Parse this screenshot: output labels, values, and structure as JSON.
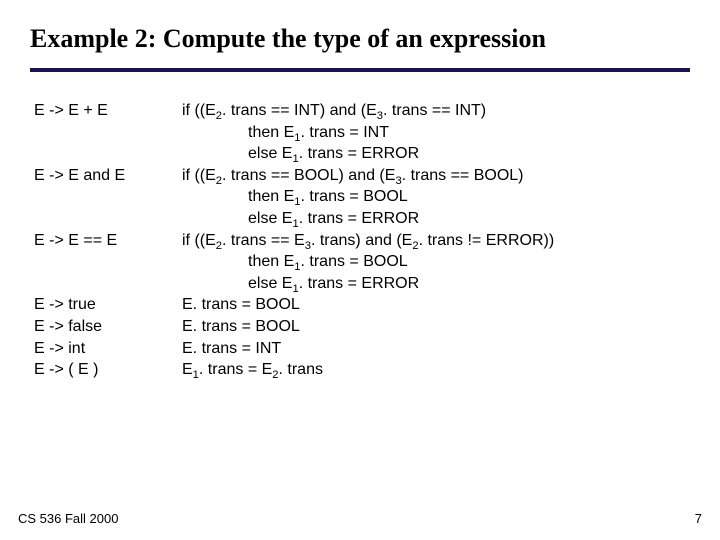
{
  "title": "Example 2: Compute the type of an expression",
  "rules": [
    {
      "lhs": "E -> E + E",
      "lines": [
        {
          "indent": false,
          "plain": "if ((E",
          "sub2": true,
          "rest": ". trans == INT) and (E",
          "sub3": true,
          "rest2": ". trans == INT)"
        },
        {
          "indent": true,
          "plain": "then E",
          "sub1": true,
          "rest": ". trans = INT"
        },
        {
          "indent": true,
          "plain": "else E",
          "sub1": true,
          "rest": ". trans = ERROR"
        }
      ]
    },
    {
      "lhs": "E -> E and E",
      "lines": [
        {
          "indent": false,
          "plain": "if ((E",
          "sub2": true,
          "rest": ". trans == BOOL) and (E",
          "sub3": true,
          "rest2": ". trans == BOOL)"
        },
        {
          "indent": true,
          "plain": "then E",
          "sub1": true,
          "rest": ". trans = BOOL"
        },
        {
          "indent": true,
          "plain": "else E",
          "sub1": true,
          "rest": ". trans = ERROR"
        }
      ]
    },
    {
      "lhs": "E -> E == E",
      "lines": [
        {
          "indent": false,
          "plain": "if ((E",
          "sub2": true,
          "rest": ". trans == E",
          "sub3": true,
          "rest2": ". trans) and (E",
          "sub2b": true,
          "rest3": ". trans != ERROR))"
        },
        {
          "indent": true,
          "plain": "then E",
          "sub1": true,
          "rest": ". trans = BOOL"
        },
        {
          "indent": true,
          "plain": "else E",
          "sub1": true,
          "rest": ". trans = ERROR"
        }
      ]
    },
    {
      "lhs": "E -> true",
      "lines": [
        {
          "indent": false,
          "full": "E. trans = BOOL"
        }
      ]
    },
    {
      "lhs": "E -> false",
      "lines": [
        {
          "indent": false,
          "full": "E. trans = BOOL"
        }
      ]
    },
    {
      "lhs": "E -> int",
      "lines": [
        {
          "indent": false,
          "full": "E. trans = INT"
        }
      ]
    },
    {
      "lhs": "E -> ( E )",
      "lines": [
        {
          "indent": false,
          "plain": "E",
          "sub1": true,
          "rest": ". trans = E",
          "sub2": true,
          "rest2": ". trans"
        }
      ]
    }
  ],
  "subs": {
    "s1": "1",
    "s2": "2",
    "s3": "3"
  },
  "footer": {
    "left": "CS 536  Fall 2000",
    "right": "7"
  }
}
